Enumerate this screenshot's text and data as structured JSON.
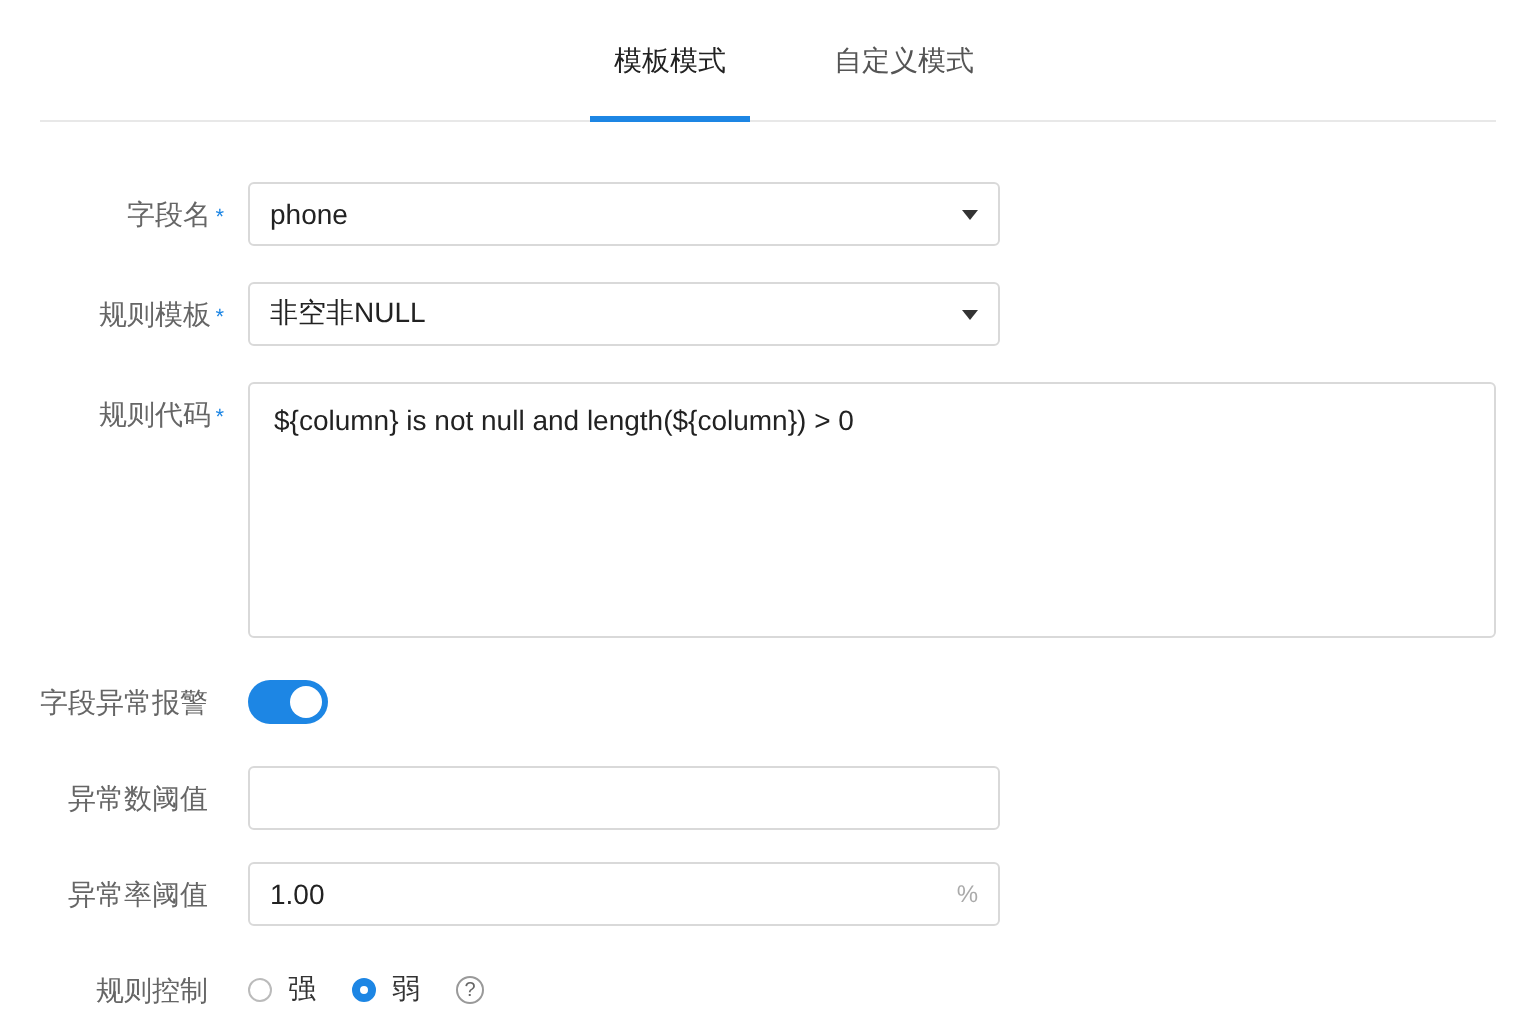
{
  "tabs": [
    {
      "label": "模板模式",
      "selected": true
    },
    {
      "label": "自定义模式",
      "selected": false
    }
  ],
  "fields": [
    {
      "kind": "select",
      "label": "字段名",
      "required_mark": "*",
      "value": "phone"
    },
    {
      "kind": "select",
      "label": "规则模板",
      "required_mark": "*",
      "value": "非空非NULL"
    },
    {
      "kind": "textarea",
      "label": "规则代码",
      "required_mark": "*",
      "value": "${column} is not null and length(${column}) > 0"
    },
    {
      "kind": "switch",
      "label": "字段异常报警",
      "on": true
    },
    {
      "kind": "input",
      "label": "异常数阈值"
    },
    {
      "kind": "input",
      "label": "异常率阈值",
      "value": "1.00",
      "suffix": "%"
    },
    {
      "kind": "radio",
      "label": "规则控制",
      "options": [
        {
          "label": "强",
          "selected": false
        },
        {
          "label": "弱",
          "selected": true
        }
      ],
      "help": "?"
    }
  ]
}
